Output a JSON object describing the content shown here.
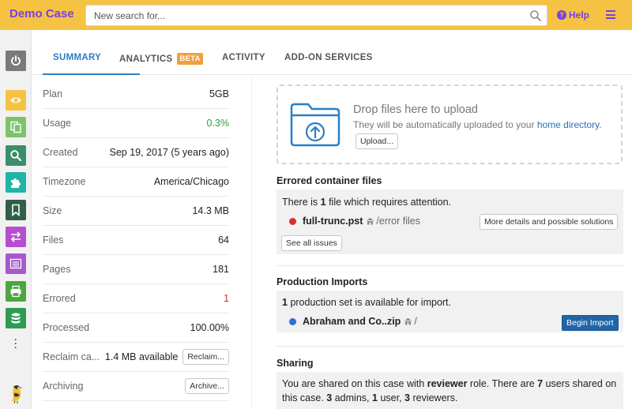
{
  "header": {
    "app_title": "Demo Case",
    "search_placeholder": "New search for...",
    "search_icon": "search-icon",
    "help_label": "Help",
    "menu_icon": "hamburger-menu-icon",
    "colors": {
      "bar": "#f5c243",
      "accent": "#7b3fe4"
    }
  },
  "rail": {
    "items": [
      {
        "name": "power",
        "icon": "power-icon",
        "color": "#7a7a7a"
      },
      {
        "name": "view",
        "icon": "eye-icon",
        "color": "#f5c243"
      },
      {
        "name": "documents",
        "icon": "documents-icon",
        "color": "#7ec36b"
      },
      {
        "name": "search",
        "icon": "search-icon",
        "color": "#3a8f6a"
      },
      {
        "name": "addons",
        "icon": "puzzle-icon",
        "color": "#21b5a5"
      },
      {
        "name": "bookmarks",
        "icon": "bookmark-icon",
        "color": "#2f5f49"
      },
      {
        "name": "transfers",
        "icon": "arrows-icon",
        "color": "#b54fd0"
      },
      {
        "name": "list",
        "icon": "list-icon",
        "color": "#a65ac8"
      },
      {
        "name": "print",
        "icon": "print-icon",
        "color": "#4ea53f"
      },
      {
        "name": "database",
        "icon": "database-icon",
        "color": "#2d9c4e"
      }
    ],
    "more_icon": "more-dots-icon",
    "logo_icon": "bird-logo-icon"
  },
  "tabs": [
    {
      "label": "SUMMARY",
      "active": true
    },
    {
      "label": "ANALYTICS",
      "badge": "BETA",
      "active": false
    },
    {
      "label": "ACTIVITY",
      "active": false
    },
    {
      "label": "ADD-ON SERVICES",
      "active": false
    }
  ],
  "summary": {
    "rows": [
      {
        "label": "Plan",
        "value": "5GB"
      },
      {
        "label": "Usage",
        "value": "0.3%",
        "color": "#27a345"
      },
      {
        "label": "Created",
        "value": "Sep 19, 2017 (5 years ago)"
      },
      {
        "label": "Timezone",
        "value": "America/Chicago"
      },
      {
        "label": "Size",
        "value": "14.3 MB"
      },
      {
        "label": "Files",
        "value": "64"
      },
      {
        "label": "Pages",
        "value": "181"
      },
      {
        "label": "Errored",
        "value": "1",
        "color": "#c9302c"
      },
      {
        "label": "Processed",
        "value": "100.00%"
      },
      {
        "label": "Reclaim ca...",
        "value": "1.4 MB available",
        "button": "Reclaim..."
      },
      {
        "label": "Archiving",
        "button": "Archive..."
      }
    ]
  },
  "upload": {
    "title": "Drop files here to upload",
    "subtitle_prefix": "They will be automatically uploaded to your",
    "subtitle_link": "home directory",
    "subtitle_suffix": ".",
    "button": "Upload..."
  },
  "errored": {
    "title": "Errored container files",
    "message_prefix": "There is",
    "message_count": "1",
    "message_suffix": "file which requires attention.",
    "file_name": "full-trunc.pst",
    "file_path": "/error files",
    "status_color": "#d9302c",
    "details_button": "More details and possible solutions",
    "see_all_button": "See all issues"
  },
  "production": {
    "title": "Production Imports",
    "message_count": "1",
    "message_suffix": "production set is available for import.",
    "file_name": "Abraham and Co..zip",
    "file_path": "/",
    "status_color": "#2f6fd8",
    "import_button": "Begin Import"
  },
  "sharing": {
    "title": "Sharing",
    "t1": "You are shared on this case with",
    "role": "reviewer",
    "t2": "role. There are",
    "users": "7",
    "t3": "users shared on this case.",
    "admins": "3",
    "t4": "admins,",
    "user_count": "1",
    "t5": "user,",
    "reviewers": "3",
    "t6": "reviewers."
  }
}
